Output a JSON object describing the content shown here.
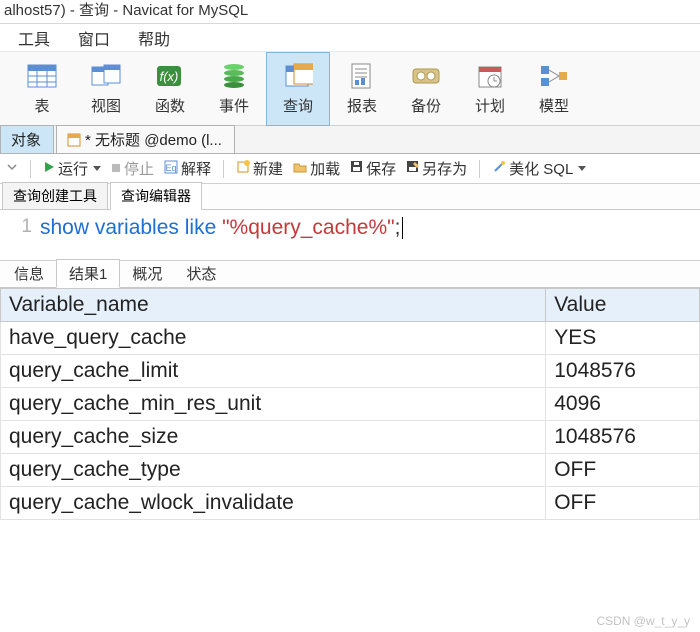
{
  "title": "alhost57) - 查询 - Navicat for MySQL",
  "menu": {
    "tools": "工具",
    "window": "窗口",
    "help": "帮助"
  },
  "ribbon": {
    "table": "表",
    "view": "视图",
    "func": "函数",
    "event": "事件",
    "query": "查询",
    "report": "报表",
    "backup": "备份",
    "plan": "计划",
    "model": "模型"
  },
  "obj_tabs": {
    "objects": "对象",
    "untitled": "* 无标题 @demo (l..."
  },
  "actions": {
    "run": "运行",
    "stop": "停止",
    "explain": "解释",
    "new": "新建",
    "load": "加载",
    "save": "保存",
    "save_as": "另存为",
    "beautify": "美化 SQL"
  },
  "inner_tabs": {
    "builder": "查询创建工具",
    "editor": "查询编辑器"
  },
  "code": {
    "line_no": "1",
    "kw": "show variables like ",
    "str": "\"%query_cache%\"",
    "tail": ";"
  },
  "result_tabs": {
    "info": "信息",
    "result": "结果1",
    "profile": "概况",
    "status": "状态"
  },
  "columns": {
    "var": "Variable_name",
    "val": "Value"
  },
  "rows": [
    {
      "var": "have_query_cache",
      "val": "YES"
    },
    {
      "var": "query_cache_limit",
      "val": "1048576"
    },
    {
      "var": "query_cache_min_res_unit",
      "val": "4096"
    },
    {
      "var": "query_cache_size",
      "val": "1048576"
    },
    {
      "var": "query_cache_type",
      "val": "OFF"
    },
    {
      "var": "query_cache_wlock_invalidate",
      "val": "OFF"
    }
  ],
  "watermark": "CSDN @w_t_y_y"
}
